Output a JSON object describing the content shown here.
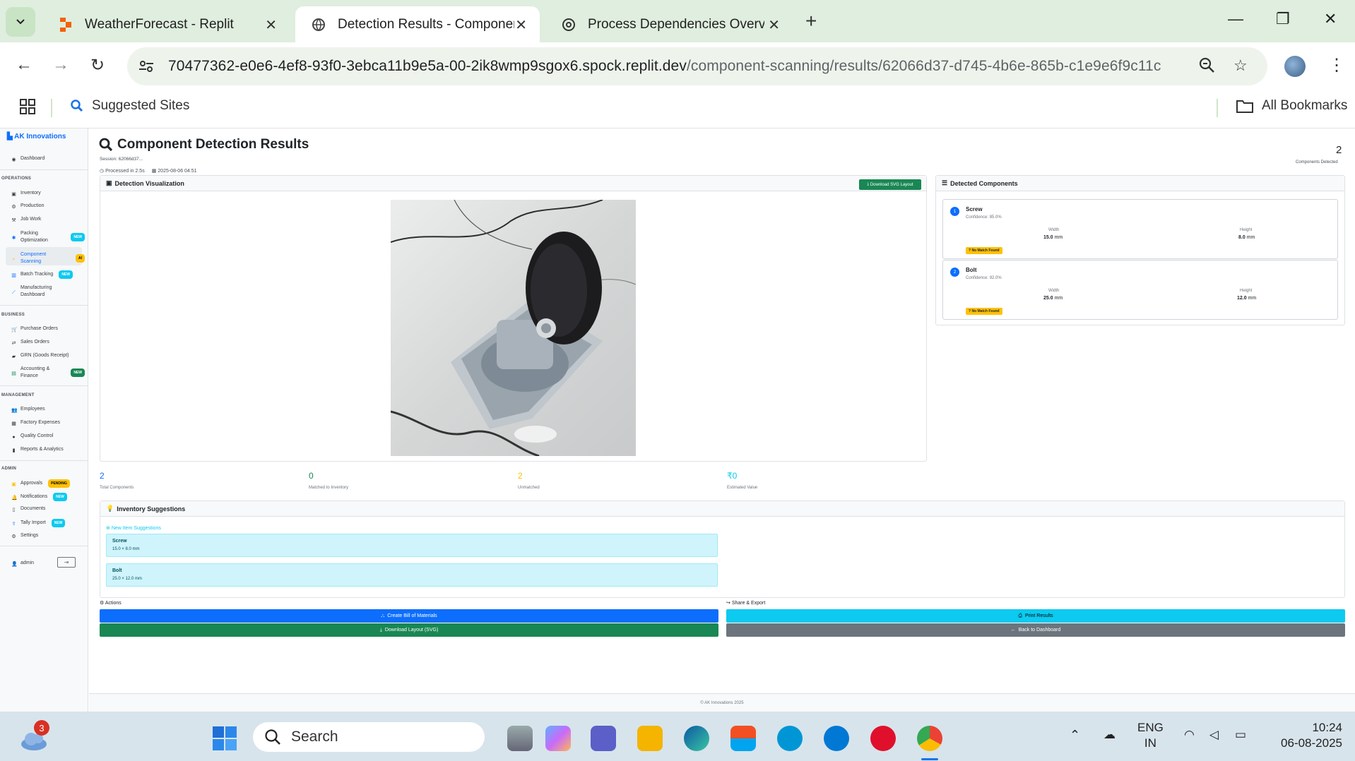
{
  "browser": {
    "tabs": [
      {
        "title": "WeatherForecast - Replit"
      },
      {
        "title": "Detection Results - Component Scanning"
      },
      {
        "title": "Process Dependencies Overview"
      }
    ],
    "url_main": "70477362-e0e6-4ef8-93f0-3ebca11b9e5a-00-2ik8wmp9sgox6.spock.replit.dev",
    "url_path": "/component-scanning/results/62066d37-d745-4b6e-865b-c1e9e6f9c11c",
    "bookmarks": {
      "suggested": "Suggested Sites",
      "all": "All Bookmarks"
    }
  },
  "sidebar": {
    "brand": "AK Innovations",
    "dashboard": "Dashboard",
    "sections": {
      "operations": "OPERATIONS",
      "business": "BUSINESS",
      "management": "MANAGEMENT",
      "admin": "ADMIN"
    },
    "operations": [
      {
        "label": "Inventory"
      },
      {
        "label": "Production"
      },
      {
        "label": "Job Work"
      },
      {
        "label": "Packing Optimization",
        "badge": "NEW"
      },
      {
        "label": "Component Scanning",
        "badge": "AI"
      },
      {
        "label": "Batch Tracking",
        "badge": "NEW"
      },
      {
        "label": "Manufacturing Dashboard"
      }
    ],
    "business": [
      {
        "label": "Purchase Orders"
      },
      {
        "label": "Sales Orders"
      },
      {
        "label": "GRN (Goods Receipt)"
      },
      {
        "label": "Accounting & Finance",
        "badge": "NEW"
      }
    ],
    "management": [
      {
        "label": "Employees"
      },
      {
        "label": "Factory Expenses"
      },
      {
        "label": "Quality Control"
      },
      {
        "label": "Reports & Analytics"
      }
    ],
    "admin": [
      {
        "label": "Approvals",
        "badge": "PENDING"
      },
      {
        "label": "Notifications",
        "badge": "NEW"
      },
      {
        "label": "Documents"
      },
      {
        "label": "Tally Import",
        "badge": "NEW"
      },
      {
        "label": "Settings"
      }
    ],
    "user": "admin"
  },
  "page": {
    "title": "Component Detection Results",
    "session": "Session: 62066d37...",
    "processed": "Processed in 2.5s",
    "date": "2025-08-06 04:51",
    "components_count": "2",
    "components_label": "Components Detected",
    "viz_title": "Detection Visualization",
    "download_svg": "Download SVG Layout",
    "detected_title": "Detected Components",
    "width_label": "Width",
    "height_label": "Height",
    "unit": "mm",
    "no_match": "No Match Found",
    "components": [
      {
        "num": "1",
        "name": "Screw",
        "confidence": "Confidence: 85.0%",
        "width": "15.0",
        "height": "8.0"
      },
      {
        "num": "2",
        "name": "Bolt",
        "confidence": "Confidence: 92.0%",
        "width": "25.0",
        "height": "12.0"
      }
    ],
    "stats": [
      {
        "value": "2",
        "label": "Total Components",
        "color": "#0d6efd"
      },
      {
        "value": "0",
        "label": "Matched to Inventory",
        "color": "#198754"
      },
      {
        "value": "2",
        "label": "Unmatched",
        "color": "#ffc107"
      },
      {
        "value": "₹0",
        "label": "Estimated Value",
        "color": "#0dcaf0"
      }
    ],
    "inventory_title": "Inventory Suggestions",
    "new_items_title": "New Item Suggestions",
    "suggestions": [
      {
        "name": "Screw",
        "dims": "15.0 × 8.0 mm"
      },
      {
        "name": "Bolt",
        "dims": "25.0 × 12.0 mm"
      }
    ],
    "actions_title": "Actions",
    "share_title": "Share & Export",
    "btn_bom": "Create Bill of Materials",
    "btn_download_layout": "Download Layout (SVG)",
    "btn_print": "Print Results",
    "btn_back": "Back to Dashboard",
    "footer": "© AK Innovations 2025"
  },
  "taskbar": {
    "search": "Search",
    "weather_badge": "3",
    "lang1": "ENG",
    "lang2": "IN",
    "time": "10:24",
    "date": "06-08-2025"
  }
}
